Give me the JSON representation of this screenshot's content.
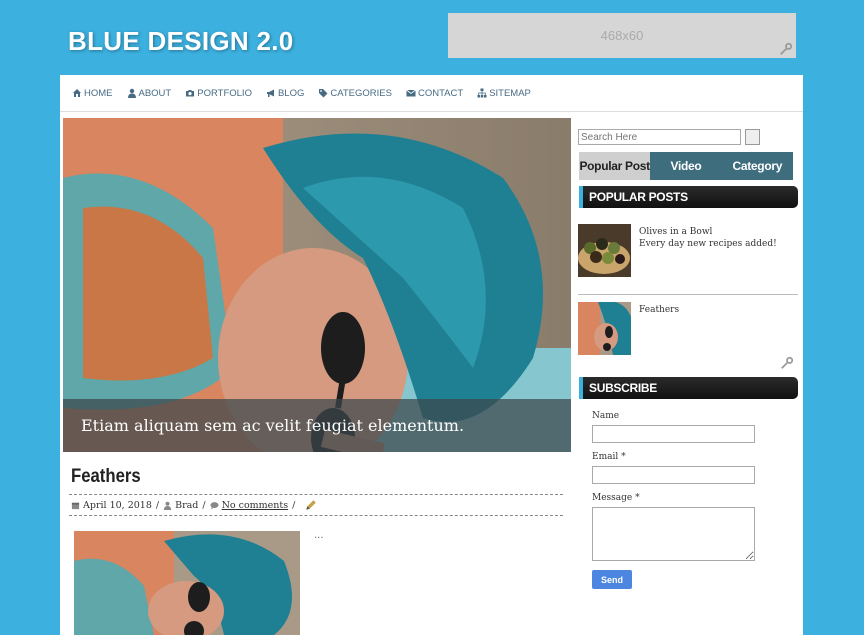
{
  "site": {
    "title": "BLUE DESIGN 2.0"
  },
  "ad": {
    "label": "468x60"
  },
  "nav": {
    "items": [
      {
        "label": "HOME",
        "icon": "home-icon"
      },
      {
        "label": "ABOUT",
        "icon": "user-icon"
      },
      {
        "label": "PORTFOLIO",
        "icon": "camera-icon"
      },
      {
        "label": "BLOG",
        "icon": "bullhorn-icon"
      },
      {
        "label": "CATEGORIES",
        "icon": "tags-icon"
      },
      {
        "label": "CONTACT",
        "icon": "envelope-icon"
      },
      {
        "label": "SITEMAP",
        "icon": "sitemap-icon"
      }
    ]
  },
  "slider": {
    "caption": "Etiam aliquam sem ac velit feugiat elementum."
  },
  "post": {
    "title": "Feathers",
    "date": "April 10, 2018",
    "author": "Brad",
    "comments": "No comments",
    "excerpt": "..."
  },
  "sidebar": {
    "search_placeholder": "Search Here",
    "tabs": [
      "Popular Post",
      "Video",
      "Category"
    ],
    "popular_title": "POPULAR POSTS",
    "popular": [
      {
        "title": "Olives in a Bowl",
        "subtitle": "Every day new recipes added!"
      },
      {
        "title": "Feathers",
        "subtitle": ""
      }
    ],
    "subscribe_title": "SUBSCRIBE",
    "form": {
      "name_label": "Name",
      "email_label": "Email *",
      "message_label": "Message *",
      "send_label": "Send"
    }
  },
  "colors": {
    "background": "#3cb0df",
    "tab_active": "#cfcfcf",
    "tab": "#3e6d7e",
    "send": "#4d86e0"
  }
}
